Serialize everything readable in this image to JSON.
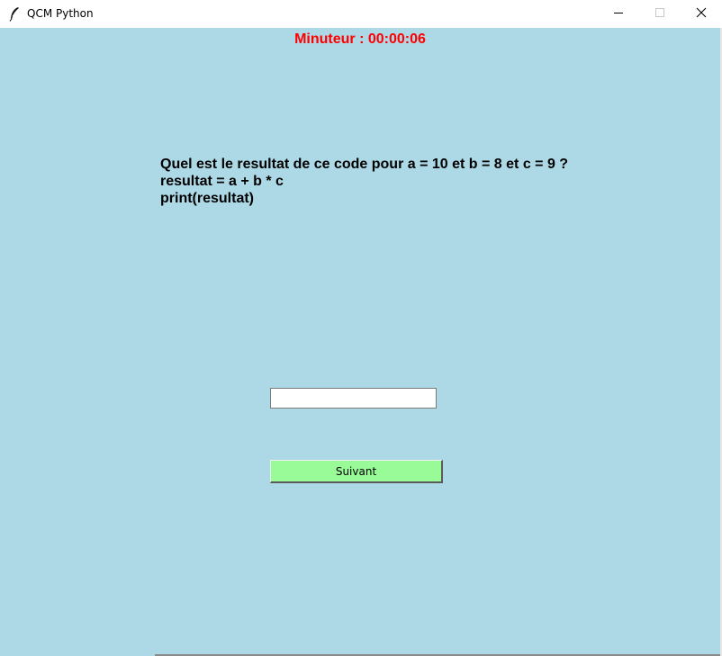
{
  "window": {
    "title": "QCM Python",
    "icon": "feather-icon",
    "controls": [
      "minimize-icon",
      "maximize-icon",
      "close-icon"
    ]
  },
  "timer": {
    "text": "Minuteur : 00:00:06",
    "color": "#ff0000"
  },
  "question": {
    "lines": [
      "Quel est le resultat de ce code pour a = 10 et b = 8 et c = 9 ?",
      "resultat = a + b * c",
      "print(resultat)"
    ]
  },
  "answer": {
    "value": "",
    "placeholder": ""
  },
  "next_button": {
    "label": "Suivant",
    "color": "#98fb98"
  },
  "colors": {
    "background": "#add8e6"
  }
}
